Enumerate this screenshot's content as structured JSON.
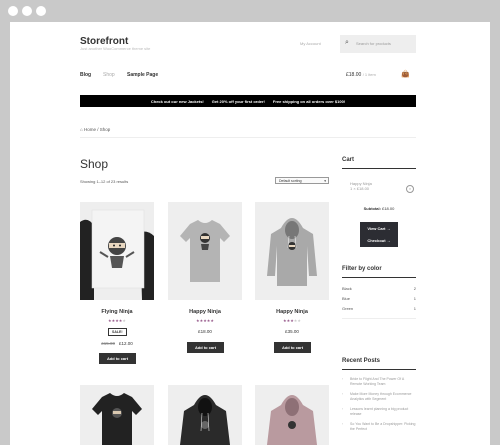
{
  "site": {
    "title": "Storefront",
    "description": "Just another WooCommerce theme site"
  },
  "header": {
    "account": "My Account",
    "search_placeholder": "Search for products",
    "cart_total": "£18.00",
    "cart_items": "1 item"
  },
  "nav": [
    "Blog",
    "Shop",
    "Sample Page"
  ],
  "banner": [
    "Check out our new Jackets!",
    "Get 20% off your first order!",
    "Free shipping on all orders over $100!"
  ],
  "breadcrumb": {
    "home": "Home",
    "sep": " / ",
    "current": "Shop"
  },
  "shop": {
    "title": "Shop",
    "results": "Showing 1–12 of 23 results",
    "sort": "Default sorting"
  },
  "products": [
    {
      "name": "Flying Ninja",
      "rating": 4,
      "sale": "SALE!",
      "old_price": "£15.00",
      "price": "£12.00",
      "button": "Add to cart"
    },
    {
      "name": "Happy Ninja",
      "rating": 5,
      "price": "£18.00",
      "button": "Add to cart"
    },
    {
      "name": "Happy Ninja",
      "rating": 3,
      "price": "£35.00",
      "button": "Add to cart"
    }
  ],
  "sidebar": {
    "cart_heading": "Cart",
    "cart_item_name": "Happy Ninja",
    "cart_item_qty": "1 × £18.00",
    "subtotal_label": "Subtotal:",
    "subtotal_value": "£18.00",
    "view_cart": "View Cart",
    "checkout": "Checkout",
    "filter_heading": "Filter by color",
    "colors": [
      {
        "name": "Black",
        "count": "2"
      },
      {
        "name": "Blue",
        "count": "1"
      },
      {
        "name": "Green",
        "count": "1"
      }
    ],
    "recent_heading": "Recent Posts",
    "posts": [
      "Bride to Flight And The Power Of A Remote Working Team",
      "Make More Money through Ecommerce Analytics with Segment",
      "Lessons learnt planning a big product release",
      "So You Want to Be a Dropshipper: Picking the Perfect"
    ]
  },
  "colors": {
    "banner": "#000000",
    "button": "#333333",
    "star": "#96588a",
    "frame": "#c9c9c9"
  }
}
